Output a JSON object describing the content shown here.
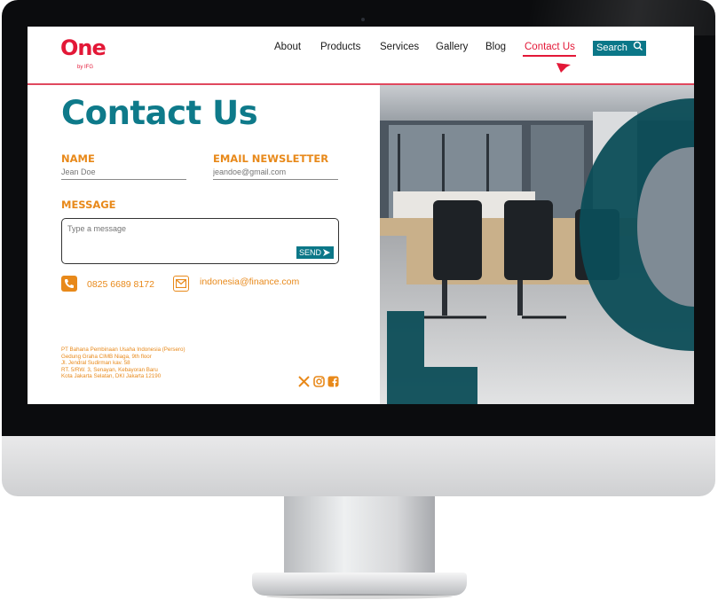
{
  "brand": {
    "logo": "One",
    "byline": "by IFG"
  },
  "nav": {
    "items": [
      "About",
      "Products",
      "Services",
      "Gallery",
      "Blog",
      "Contact Us"
    ],
    "active": "Contact Us",
    "search_label": "Search"
  },
  "page": {
    "title": "Contact Us"
  },
  "form": {
    "name_label": "NAME",
    "name_placeholder": "Jean Doe",
    "email_label": "EMAIL NEWSLETTER",
    "email_placeholder": "jeandoe@gmail.com",
    "message_label": "MESSAGE",
    "message_placeholder": "Type a message",
    "send_label": "SEND"
  },
  "contact": {
    "phone": "0825 6689 8172",
    "email": "indonesia@finance.com"
  },
  "address": [
    "PT Bahana Pembinaan Usaha Indonesia (Persero)",
    "Gedung Graha CIMB Niaga, 9th floor",
    "Jl. Jendral Sudirman kav. 58",
    "RT. 5/RW. 3, Senayan, Kebayoran Baru",
    "Kota Jakarta Selatan, DKI Jakarta 12190"
  ],
  "colors": {
    "teal": "#0e7a8a",
    "orange": "#e8891a",
    "red": "#e31837",
    "dark_teal": "#0c4d57"
  },
  "icons": [
    "search-icon",
    "send-arrow-icon",
    "phone-icon",
    "mail-icon",
    "x-icon",
    "instagram-icon",
    "facebook-icon",
    "cursor-icon"
  ]
}
